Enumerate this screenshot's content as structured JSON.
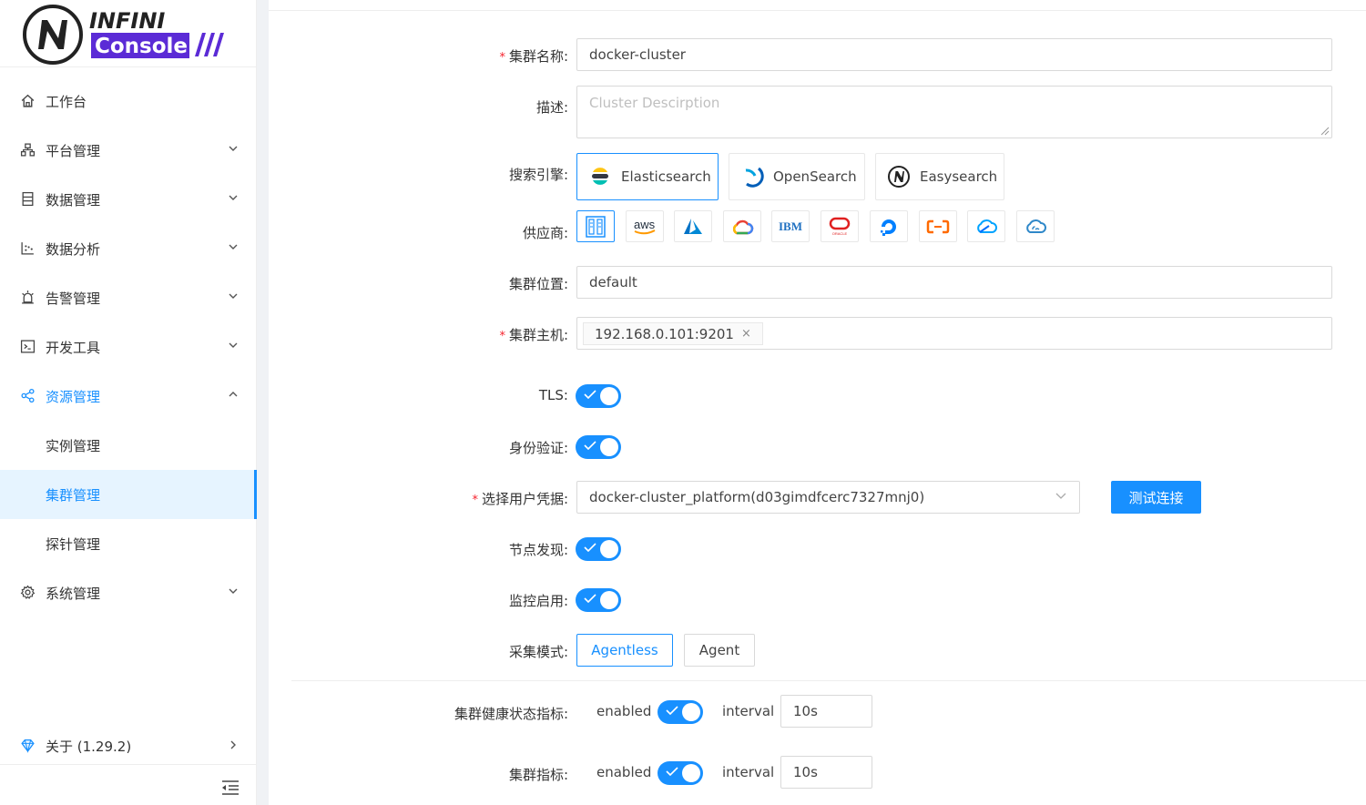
{
  "brand": {
    "name_top": "INFINI",
    "name_bottom": "Console",
    "colors": {
      "primary": "#1890ff",
      "brand_purple": "#5b2bd6"
    }
  },
  "sidebar": {
    "items": [
      {
        "label": "工作台",
        "icon": "home-icon"
      },
      {
        "label": "平台管理",
        "icon": "sitemap-icon"
      },
      {
        "label": "数据管理",
        "icon": "database-icon"
      },
      {
        "label": "数据分析",
        "icon": "chart-icon"
      },
      {
        "label": "告警管理",
        "icon": "alarm-icon"
      },
      {
        "label": "开发工具",
        "icon": "terminal-icon"
      },
      {
        "label": "资源管理",
        "icon": "share-icon"
      },
      {
        "label": "实例管理"
      },
      {
        "label": "集群管理"
      },
      {
        "label": "探针管理"
      },
      {
        "label": "系统管理",
        "icon": "gear-icon"
      }
    ],
    "about": "关于 (1.29.2)"
  },
  "form": {
    "cluster_name": {
      "label": "集群名称:",
      "value": "docker-cluster"
    },
    "description": {
      "label": "描述:",
      "placeholder": "Cluster Descirption"
    },
    "engine": {
      "label": "搜索引擎:",
      "options": [
        "Elasticsearch",
        "OpenSearch",
        "Easysearch"
      ],
      "selected": "Elasticsearch"
    },
    "provider": {
      "label": "供应商:",
      "options": [
        "on-premise-icon",
        "aws-icon",
        "azure-icon",
        "google-cloud-icon",
        "ibm-icon",
        "oracle-icon",
        "digitalocean-icon",
        "alibaba-cloud-icon",
        "tencent-cloud-icon",
        "huawei-cloud-icon"
      ],
      "aws_text": "aws",
      "ibm_text": "IBM",
      "oracle_text": "ORACLE"
    },
    "location": {
      "label": "集群位置:",
      "value": "default"
    },
    "hosts": {
      "label": "集群主机:",
      "tags": [
        "192.168.0.101:9201"
      ],
      "remove": "×"
    },
    "tls": {
      "label": "TLS:",
      "on": true
    },
    "auth": {
      "label": "身份验证:",
      "on": true
    },
    "credential": {
      "label": "选择用户凭据:",
      "value": "docker-cluster_platform(d03gimdfcerc7327mnj0)",
      "test_button": "测试连接"
    },
    "discovery": {
      "label": "节点发现:",
      "on": true
    },
    "monitor": {
      "label": "监控启用:",
      "on": true
    },
    "collect_mode": {
      "label": "采集模式:",
      "options": [
        "Agentless",
        "Agent"
      ],
      "selected": "Agentless"
    },
    "health_metric": {
      "label": "集群健康状态指标:",
      "enabled_text": "enabled",
      "interval_text": "interval",
      "interval": "10s",
      "on": true
    },
    "cluster_metric": {
      "label": "集群指标:",
      "enabled_text": "enabled",
      "interval_text": "interval",
      "interval": "10s",
      "on": true
    }
  }
}
